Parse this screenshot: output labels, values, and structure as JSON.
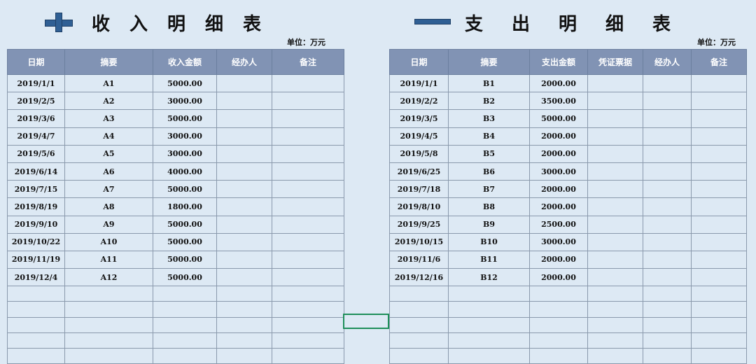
{
  "income": {
    "title_chars": [
      "收",
      "入",
      "明",
      "细",
      "表"
    ],
    "unit": "单位：万元",
    "headers": [
      "日期",
      "摘要",
      "收入金额",
      "经办人",
      "备注"
    ],
    "rows": [
      [
        "2019/1/1",
        "A1",
        "5000.00",
        "",
        ""
      ],
      [
        "2019/2/5",
        "A2",
        "3000.00",
        "",
        ""
      ],
      [
        "2019/3/6",
        "A3",
        "5000.00",
        "",
        ""
      ],
      [
        "2019/4/7",
        "A4",
        "3000.00",
        "",
        ""
      ],
      [
        "2019/5/6",
        "A5",
        "3000.00",
        "",
        ""
      ],
      [
        "2019/6/14",
        "A6",
        "4000.00",
        "",
        ""
      ],
      [
        "2019/7/15",
        "A7",
        "5000.00",
        "",
        ""
      ],
      [
        "2019/8/19",
        "A8",
        "1800.00",
        "",
        ""
      ],
      [
        "2019/9/10",
        "A9",
        "5000.00",
        "",
        ""
      ],
      [
        "2019/10/22",
        "A10",
        "5000.00",
        "",
        ""
      ],
      [
        "2019/11/19",
        "A11",
        "5000.00",
        "",
        ""
      ],
      [
        "2019/12/4",
        "A12",
        "5000.00",
        "",
        ""
      ]
    ]
  },
  "expense": {
    "title_chars": [
      "支",
      "出",
      "明",
      "细",
      "表"
    ],
    "unit": "单位：万元",
    "headers": [
      "日期",
      "摘要",
      "支出金额",
      "凭证票据",
      "经办人",
      "备注"
    ],
    "rows": [
      [
        "2019/1/1",
        "B1",
        "2000.00",
        "",
        "",
        ""
      ],
      [
        "2019/2/2",
        "B2",
        "3500.00",
        "",
        "",
        ""
      ],
      [
        "2019/3/5",
        "B3",
        "5000.00",
        "",
        "",
        ""
      ],
      [
        "2019/4/5",
        "B4",
        "2000.00",
        "",
        "",
        ""
      ],
      [
        "2019/5/8",
        "B5",
        "2000.00",
        "",
        "",
        ""
      ],
      [
        "2019/6/25",
        "B6",
        "3000.00",
        "",
        "",
        ""
      ],
      [
        "2019/7/18",
        "B7",
        "2000.00",
        "",
        "",
        ""
      ],
      [
        "2019/8/10",
        "B8",
        "2000.00",
        "",
        "",
        ""
      ],
      [
        "2019/9/25",
        "B9",
        "2500.00",
        "",
        "",
        ""
      ],
      [
        "2019/10/15",
        "B10",
        "3000.00",
        "",
        "",
        ""
      ],
      [
        "2019/11/6",
        "B11",
        "2000.00",
        "",
        "",
        ""
      ],
      [
        "2019/12/16",
        "B12",
        "2000.00",
        "",
        "",
        ""
      ]
    ]
  },
  "icons": {
    "income": "plus-icon",
    "expense": "minus-icon"
  },
  "colors": {
    "header_bg": "#8193b4",
    "sheet_bg": "#dde9f4",
    "icon": "#2f5f94",
    "selection": "#1e8f5a"
  }
}
